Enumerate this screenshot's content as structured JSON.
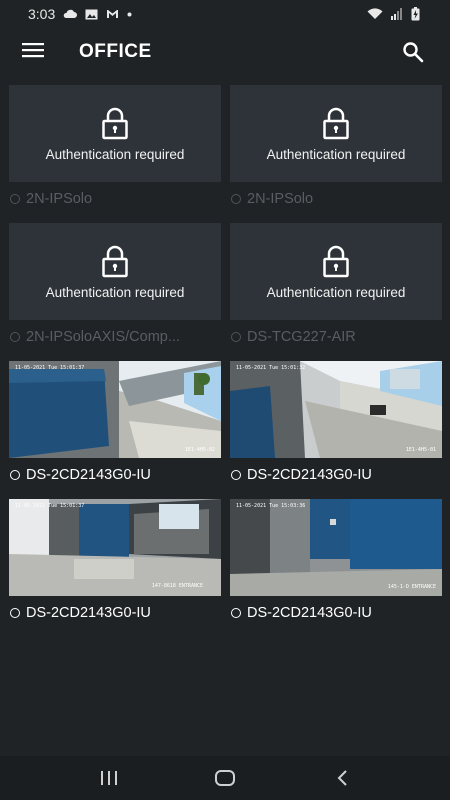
{
  "status": {
    "time": "3:03",
    "icons_left": [
      "cloud-icon",
      "image-icon",
      "gmail-icon",
      "dot-icon"
    ],
    "icons_right": [
      "wifi-icon",
      "signal-icon",
      "battery-icon"
    ]
  },
  "appbar": {
    "title": "OFFICE",
    "menu_icon": "hamburger-menu-icon",
    "search_icon": "search-icon"
  },
  "cameras": [
    {
      "name": "2N-IPSolo",
      "state": "auth",
      "message": "Authentication required"
    },
    {
      "name": "2N-IPSolo",
      "state": "auth",
      "message": "Authentication required"
    },
    {
      "name": "2N-IPSoloAXIS/Comp...",
      "state": "auth",
      "message": "Authentication required"
    },
    {
      "name": "DS-TCG227-AIR",
      "state": "auth",
      "message": "Authentication required"
    },
    {
      "name": "DS-2CD2143G0-IU",
      "state": "live",
      "osd_time": "11-05-2021 Tue 15:01:37",
      "osd_label": "1E1-4H5-02"
    },
    {
      "name": "DS-2CD2143G0-IU",
      "state": "live",
      "osd_time": "11-05-2021 Tue 15:01:32",
      "osd_label": "1E1-4H5-01"
    },
    {
      "name": "DS-2CD2143G0-IU",
      "state": "live",
      "osd_time": "11-05-2021 Tue 15:01:37",
      "osd_label": "147-8618 ENTRANCE"
    },
    {
      "name": "DS-2CD2143G0-IU",
      "state": "live",
      "osd_time": "11-05-2021 Tue 15:03:36",
      "osd_label": "145-1-D ENTRANCE"
    }
  ],
  "navbar": {
    "recents_icon": "recent-apps-icon",
    "home_icon": "home-icon",
    "back_icon": "back-icon"
  },
  "colors": {
    "background": "#1f2326",
    "tile": "#2d3338",
    "muted_text": "#585e63"
  }
}
